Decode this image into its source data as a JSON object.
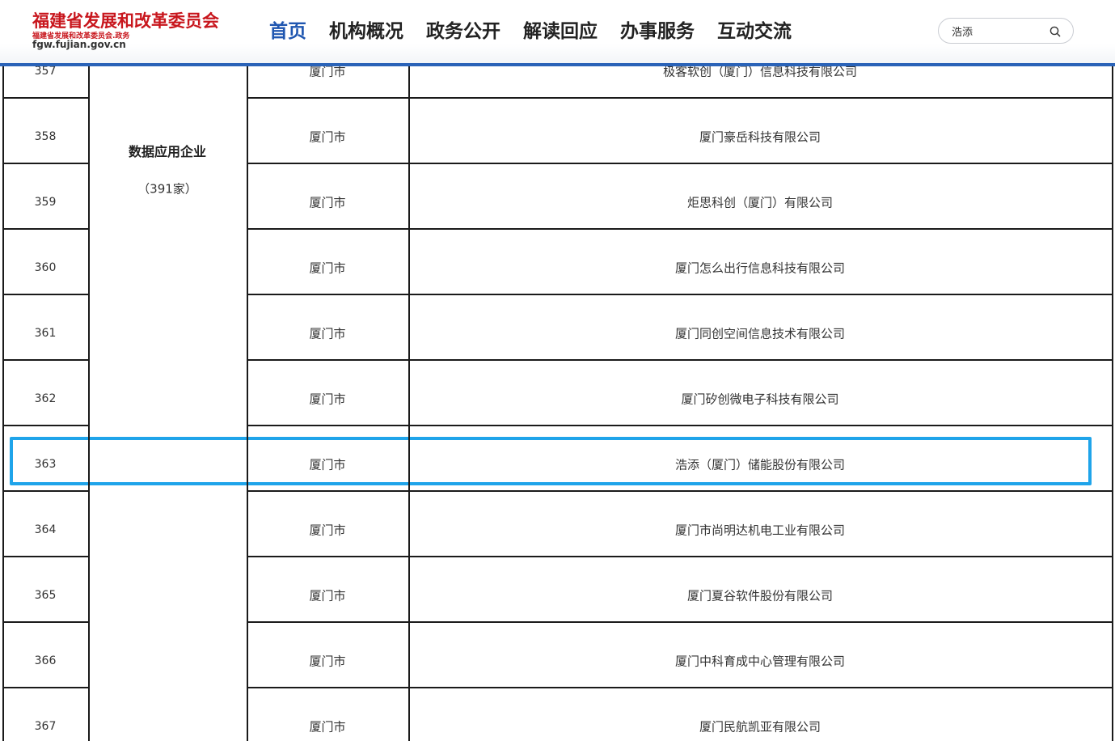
{
  "header": {
    "logo": {
      "title": "福建省发展和改革委员会",
      "subtitle": "福建省发展和改革委员会.政务",
      "url": "fgw.fujian.gov.cn"
    },
    "nav": [
      {
        "label": "首页",
        "active": true
      },
      {
        "label": "机构概况",
        "active": false
      },
      {
        "label": "政务公开",
        "active": false
      },
      {
        "label": "解读回应",
        "active": false
      },
      {
        "label": "办事服务",
        "active": false
      },
      {
        "label": "互动交流",
        "active": false
      }
    ],
    "search": {
      "value": "浩添",
      "icon": "search-icon"
    },
    "accent_color": "#2a63b8",
    "logo_color": "#c8161d"
  },
  "table": {
    "category": {
      "name": "数据应用企业",
      "count": "（391家）"
    },
    "rows": [
      {
        "no": "357",
        "city": "厦门市",
        "company": "极客软创（厦门）信息科技有限公司"
      },
      {
        "no": "358",
        "city": "厦门市",
        "company": "厦门豪岳科技有限公司"
      },
      {
        "no": "359",
        "city": "厦门市",
        "company": "炬思科创（厦门）有限公司"
      },
      {
        "no": "360",
        "city": "厦门市",
        "company": "厦门怎么出行信息科技有限公司"
      },
      {
        "no": "361",
        "city": "厦门市",
        "company": "厦门同创空间信息技术有限公司"
      },
      {
        "no": "362",
        "city": "厦门市",
        "company": "厦门矽创微电子科技有限公司"
      },
      {
        "no": "363",
        "city": "厦门市",
        "company": "浩添（厦门）储能股份有限公司",
        "highlighted": true
      },
      {
        "no": "364",
        "city": "厦门市",
        "company": "厦门市尚明达机电工业有限公司"
      },
      {
        "no": "365",
        "city": "厦门市",
        "company": "厦门夏谷软件股份有限公司"
      },
      {
        "no": "366",
        "city": "厦门市",
        "company": "厦门中科育成中心管理有限公司"
      },
      {
        "no": "367",
        "city": "厦门市",
        "company": "厦门民航凯亚有限公司"
      }
    ],
    "highlight_color": "#1fa4ea"
  }
}
